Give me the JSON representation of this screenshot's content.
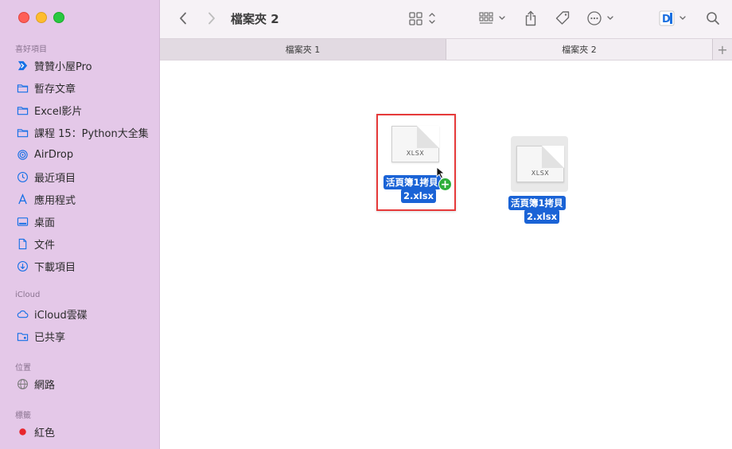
{
  "window": {
    "title": "檔案夾 2"
  },
  "sidebar": {
    "favorites_title": "喜好項目",
    "favorites": [
      {
        "label": "贊贊小屋Pro",
        "icon": "brand-logo-icon"
      },
      {
        "label": "暫存文章",
        "icon": "folder-icon"
      },
      {
        "label": "Excel影片",
        "icon": "folder-icon"
      },
      {
        "label": "課程 15：Python大全集",
        "icon": "folder-icon"
      },
      {
        "label": "AirDrop",
        "icon": "airdrop-icon"
      },
      {
        "label": "最近項目",
        "icon": "clock-icon"
      },
      {
        "label": "應用程式",
        "icon": "applications-icon"
      },
      {
        "label": "桌面",
        "icon": "desktop-icon"
      },
      {
        "label": "文件",
        "icon": "document-icon"
      },
      {
        "label": "下載項目",
        "icon": "download-icon"
      }
    ],
    "icloud_title": "iCloud",
    "icloud": [
      {
        "label": "iCloud雲碟",
        "icon": "cloud-icon"
      },
      {
        "label": "已共享",
        "icon": "shared-folder-icon"
      }
    ],
    "locations_title": "位置",
    "locations": [
      {
        "label": "網路",
        "icon": "network-icon"
      }
    ],
    "tags_title": "標籤",
    "tags": [
      {
        "label": "紅色",
        "icon": "red-tag-dot",
        "color": "#e8262c"
      }
    ]
  },
  "tabs": [
    {
      "label": "檔案夾 1",
      "active": false
    },
    {
      "label": "檔案夾 2",
      "active": true
    }
  ],
  "tab_add_label": "+",
  "files": [
    {
      "ext_label": "XLSX",
      "name_line1": "活頁簿1拷貝",
      "name_line2": "2.xlsx",
      "selected": true,
      "dragging": true
    },
    {
      "ext_label": "XLSX",
      "name_line1": "活頁簿1拷貝",
      "name_line2": "2.xlsx",
      "selected": true,
      "dragging": false
    }
  ],
  "drag_badge": "+",
  "colors": {
    "sidebar": "#e4c8e8",
    "accent": "#1a63d6",
    "highlight_box": "#e63a3a",
    "copy_badge": "#2fae3a"
  }
}
